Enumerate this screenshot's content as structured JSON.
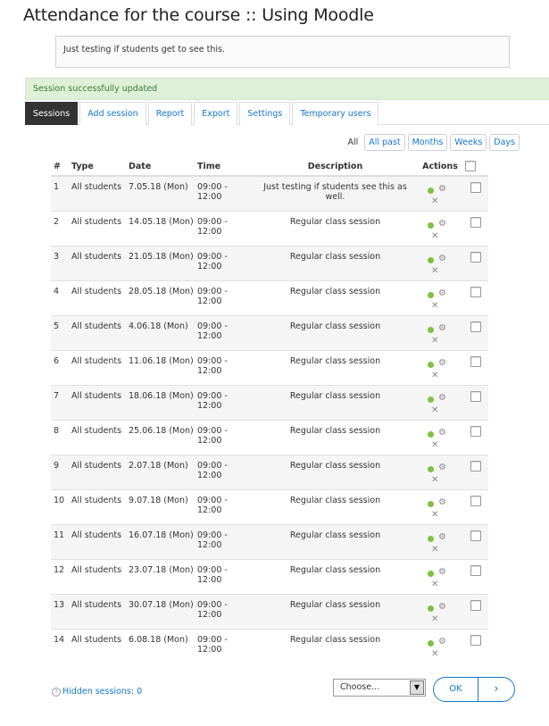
{
  "page": {
    "title": "Attendance for the course :: Using Moodle"
  },
  "intro": {
    "text": "Just testing if students get to see this."
  },
  "alert": {
    "text": "Session successfully updated"
  },
  "tabs": [
    {
      "label": "Sessions",
      "active": true
    },
    {
      "label": "Add session"
    },
    {
      "label": "Report"
    },
    {
      "label": "Export"
    },
    {
      "label": "Settings"
    },
    {
      "label": "Temporary users"
    }
  ],
  "view": {
    "label": "All",
    "buttons": [
      "All past",
      "Months",
      "Weeks",
      "Days"
    ]
  },
  "table": {
    "headers": {
      "num": "#",
      "type": "Type",
      "date": "Date",
      "time": "Time",
      "description": "Description",
      "actions": "Actions"
    },
    "rows": [
      {
        "num": "1",
        "type": "All students",
        "date": "7.05.18 (Mon)",
        "time": "09:00 - 12:00",
        "description": "Just testing if students see this as well."
      },
      {
        "num": "2",
        "type": "All students",
        "date": "14.05.18 (Mon)",
        "time": "09:00 - 12:00",
        "description": "Regular class session"
      },
      {
        "num": "3",
        "type": "All students",
        "date": "21.05.18 (Mon)",
        "time": "09:00 - 12:00",
        "description": "Regular class session"
      },
      {
        "num": "4",
        "type": "All students",
        "date": "28.05.18 (Mon)",
        "time": "09:00 - 12:00",
        "description": "Regular class session"
      },
      {
        "num": "5",
        "type": "All students",
        "date": "4.06.18 (Mon)",
        "time": "09:00 - 12:00",
        "description": "Regular class session"
      },
      {
        "num": "6",
        "type": "All students",
        "date": "11.06.18 (Mon)",
        "time": "09:00 - 12:00",
        "description": "Regular class session"
      },
      {
        "num": "7",
        "type": "All students",
        "date": "18.06.18 (Mon)",
        "time": "09:00 - 12:00",
        "description": "Regular class session"
      },
      {
        "num": "8",
        "type": "All students",
        "date": "25.06.18 (Mon)",
        "time": "09:00 - 12:00",
        "description": "Regular class session"
      },
      {
        "num": "9",
        "type": "All students",
        "date": "2.07.18 (Mon)",
        "time": "09:00 - 12:00",
        "description": "Regular class session"
      },
      {
        "num": "10",
        "type": "All students",
        "date": "9.07.18 (Mon)",
        "time": "09:00 - 12:00",
        "description": "Regular class session"
      },
      {
        "num": "11",
        "type": "All students",
        "date": "16.07.18 (Mon)",
        "time": "09:00 - 12:00",
        "description": "Regular class session"
      },
      {
        "num": "12",
        "type": "All students",
        "date": "23.07.18 (Mon)",
        "time": "09:00 - 12:00",
        "description": "Regular class session"
      },
      {
        "num": "13",
        "type": "All students",
        "date": "30.07.18 (Mon)",
        "time": "09:00 - 12:00",
        "description": "Regular class session"
      },
      {
        "num": "14",
        "type": "All students",
        "date": "6.08.18 (Mon)",
        "time": "09:00 - 12:00",
        "description": "Regular class session"
      }
    ],
    "action_icons": {
      "take": "green-dot-icon",
      "edit": "gear-icon",
      "delete": "close-icon"
    }
  },
  "footer": {
    "hidden_sessions": "Hidden sessions: 0",
    "select_value": "Choose...",
    "ok_label": "OK",
    "next_glyph": "›"
  },
  "colors": {
    "link": "#1177d1",
    "success_bg": "#dff0d8",
    "success_text": "#3c763d",
    "active_tab": "#333333",
    "status_dot": "#7cc242"
  }
}
